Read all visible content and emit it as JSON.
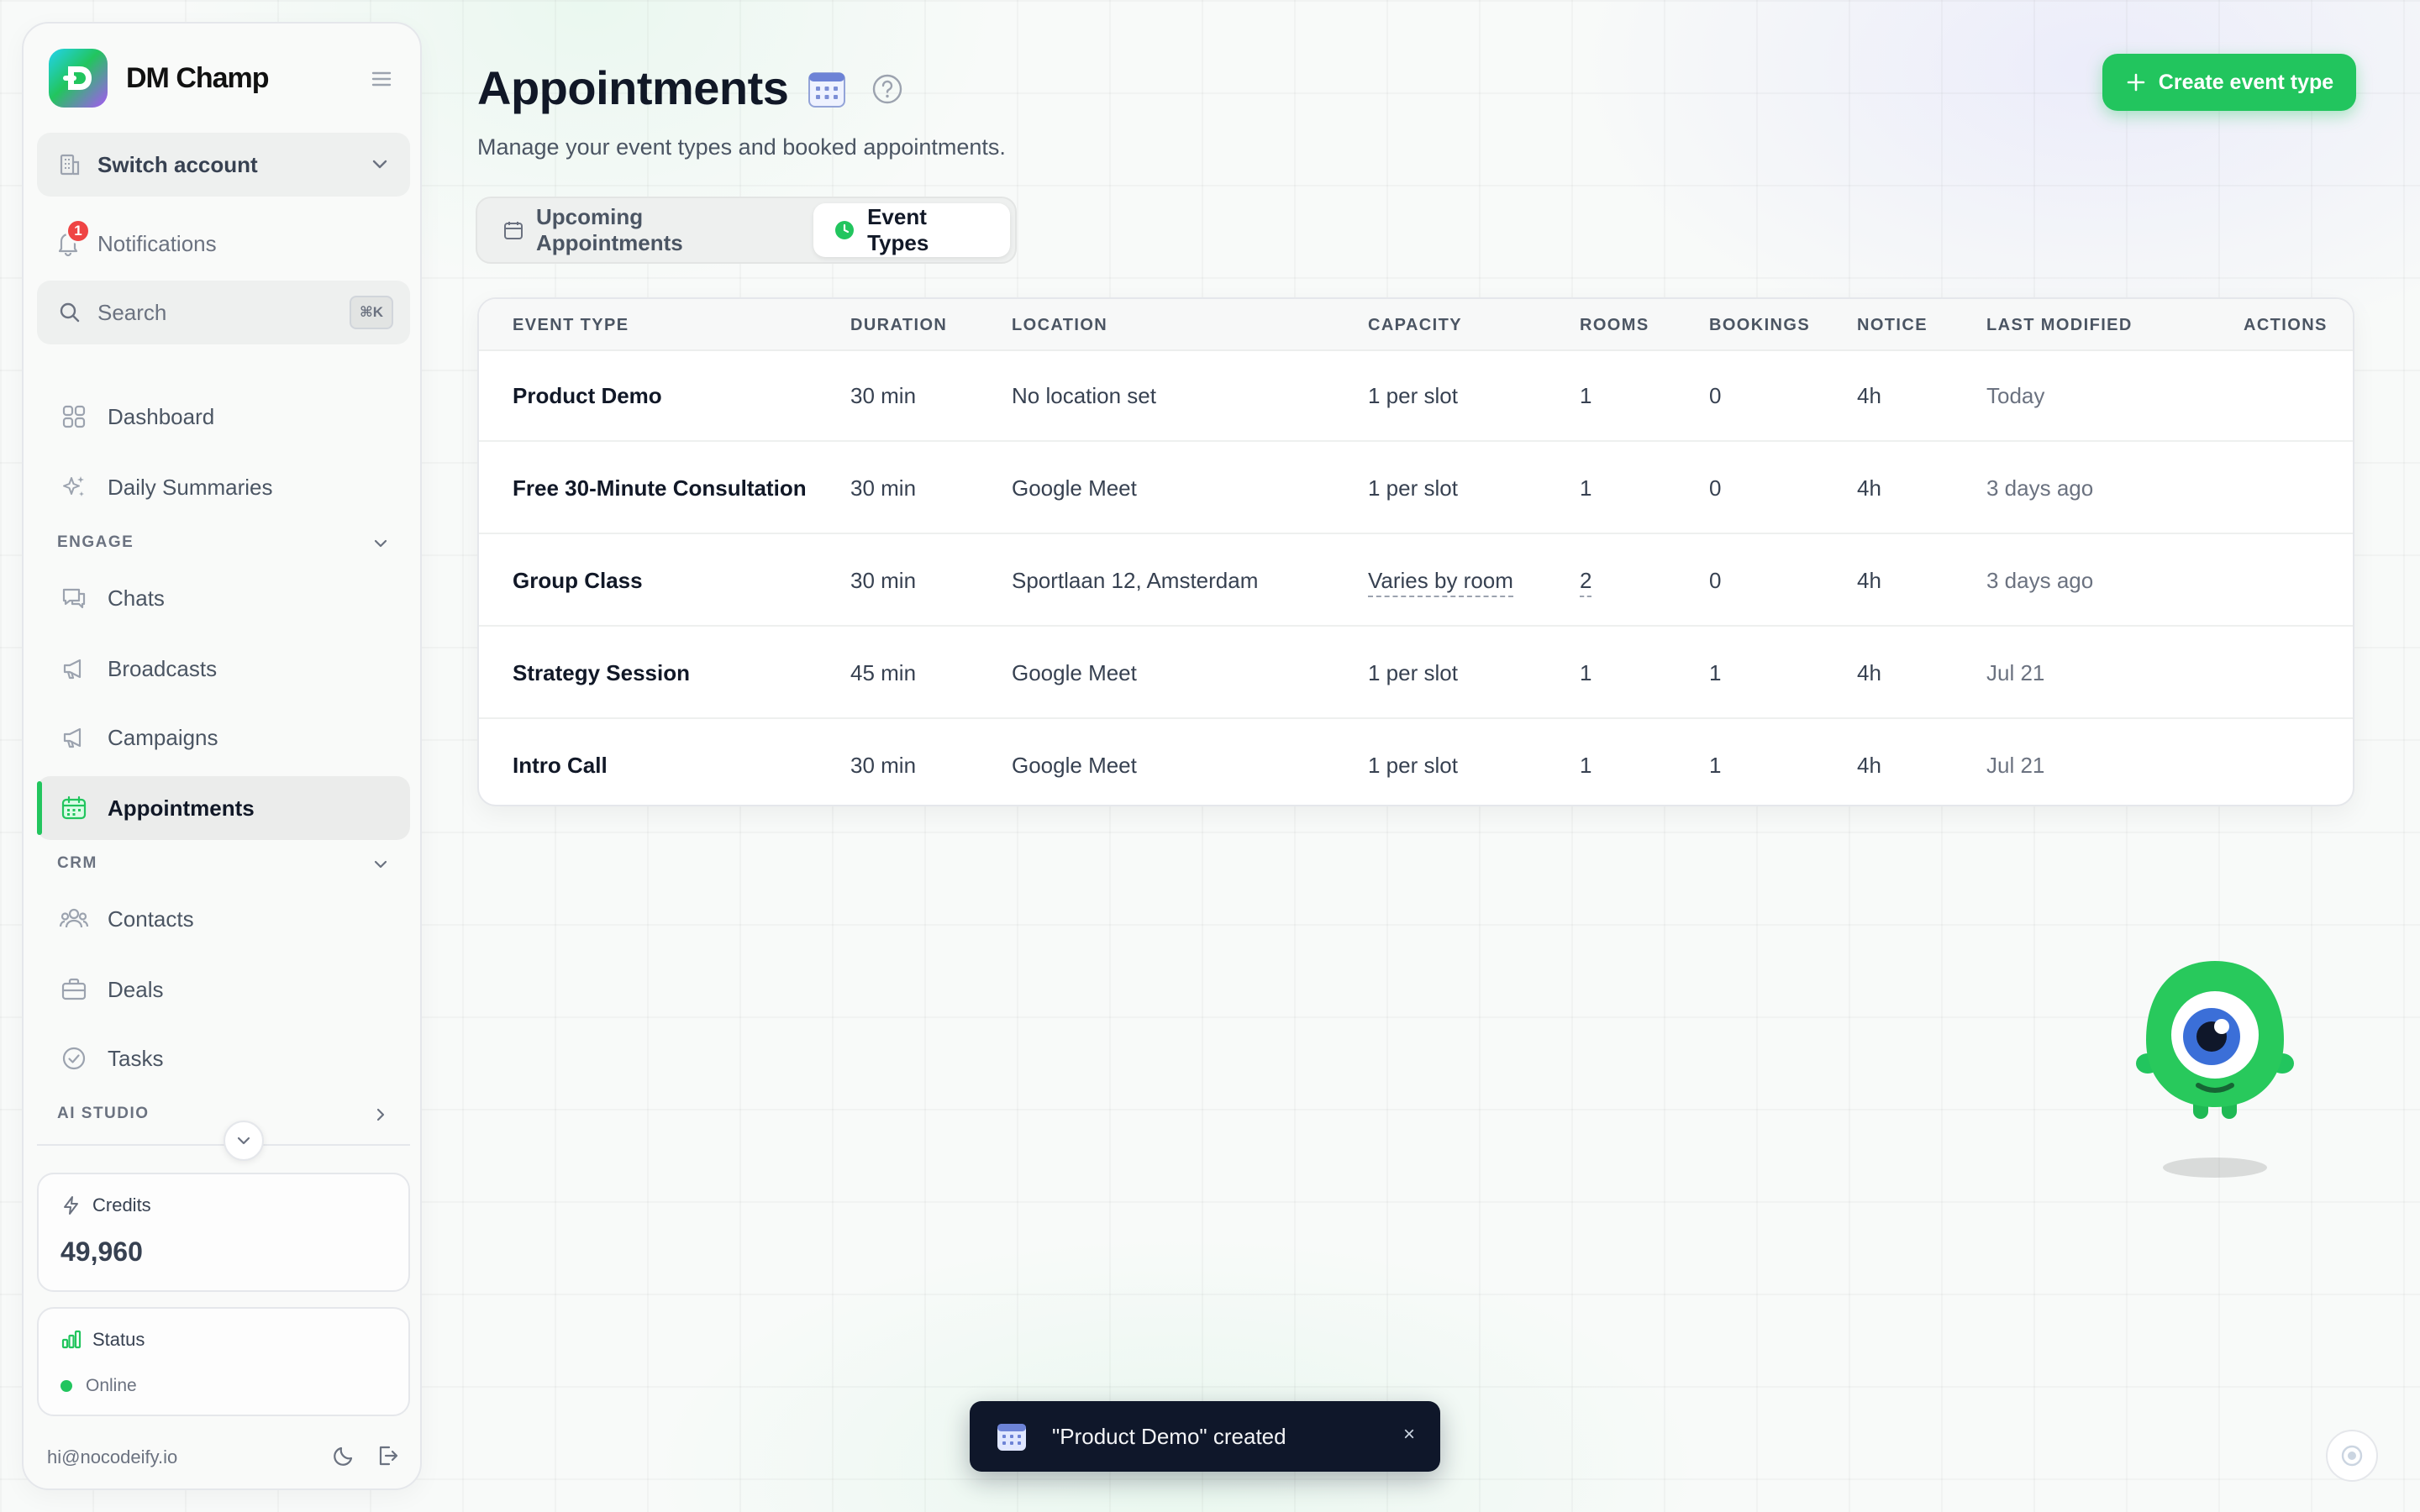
{
  "brand": {
    "name": "DM Champ"
  },
  "sidebar": {
    "switch_account": "Switch account",
    "notifications": {
      "label": "Notifications",
      "count": "1"
    },
    "search": {
      "placeholder": "Search",
      "shortcut": "⌘K"
    },
    "items": {
      "dashboard": "Dashboard",
      "daily_summaries": "Daily Summaries",
      "chats": "Chats",
      "broadcasts": "Broadcasts",
      "campaigns": "Campaigns",
      "appointments": "Appointments",
      "contacts": "Contacts",
      "deals": "Deals",
      "tasks": "Tasks"
    },
    "sections": {
      "engage": "ENGAGE",
      "crm": "CRM",
      "ai_studio": "AI STUDIO"
    },
    "credits": {
      "label": "Credits",
      "value": "49,960"
    },
    "status": {
      "label": "Status",
      "value": "Online"
    },
    "email": "hi@nocodeify.io",
    "active_accent": "#22c55e"
  },
  "page": {
    "title": "Appointments",
    "subtitle": "Manage your event types and booked appointments.",
    "create_button": "Create event type"
  },
  "tabs": [
    {
      "label": "Upcoming Appointments",
      "active": false
    },
    {
      "label": "Event Types",
      "active": true
    }
  ],
  "table": {
    "columns": {
      "event_type": "EVENT TYPE",
      "duration": "DURATION",
      "location": "LOCATION",
      "capacity": "CAPACITY",
      "rooms": "ROOMS",
      "bookings": "BOOKINGS",
      "notice": "NOTICE",
      "last_modified": "LAST MODIFIED",
      "actions": "ACTIONS"
    },
    "rows": [
      {
        "name": "Product Demo",
        "duration": "30 min",
        "location": "No location set",
        "capacity": "1 per slot",
        "rooms": "1",
        "bookings": "0",
        "notice": "4h",
        "modified": "Today"
      },
      {
        "name": "Free 30-Minute Consultation",
        "duration": "30 min",
        "location": "Google Meet",
        "capacity": "1 per slot",
        "rooms": "1",
        "bookings": "0",
        "notice": "4h",
        "modified": "3 days ago"
      },
      {
        "name": "Group Class",
        "duration": "30 min",
        "location": "Sportlaan 12, Amsterdam",
        "capacity": "Varies by room",
        "rooms": "2",
        "bookings": "0",
        "notice": "4h",
        "modified": "3 days ago"
      },
      {
        "name": "Strategy Session",
        "duration": "45 min",
        "location": "Google Meet",
        "capacity": "1 per slot",
        "rooms": "1",
        "bookings": "1",
        "notice": "4h",
        "modified": "Jul 21"
      },
      {
        "name": "Intro Call",
        "duration": "30 min",
        "location": "Google Meet",
        "capacity": "1 per slot",
        "rooms": "1",
        "bookings": "1",
        "notice": "4h",
        "modified": "Jul 21"
      }
    ]
  },
  "toast": {
    "message": "\"Product Demo\" created",
    "close": "×"
  },
  "colors": {
    "primary": "#22c55e",
    "toast_bg": "#0f172a",
    "badge": "#ef4444"
  }
}
